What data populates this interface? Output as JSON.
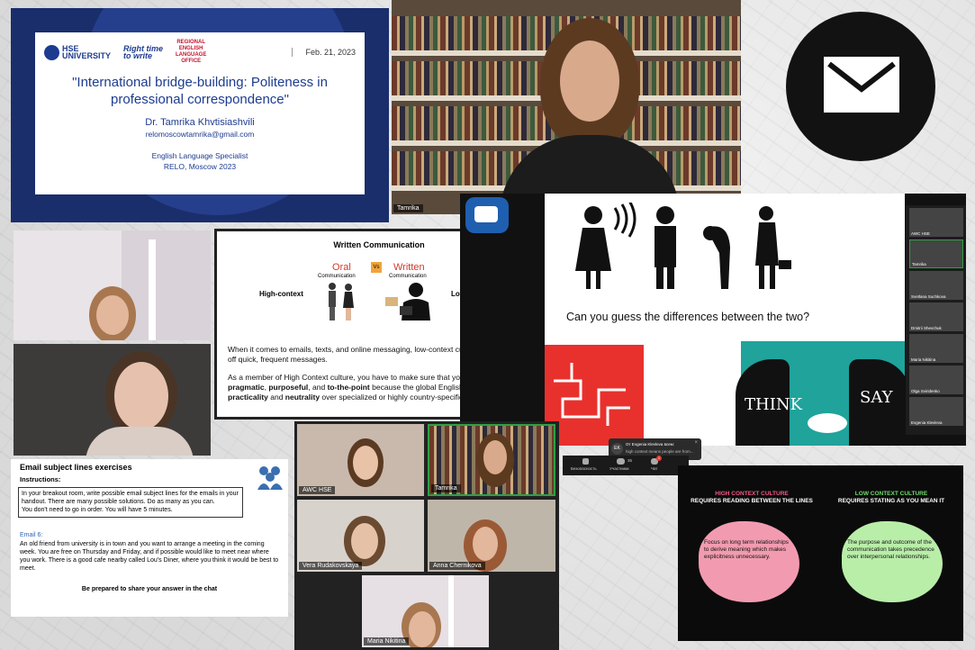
{
  "title_slide": {
    "logos": {
      "hse": "HSE\nUNIVERSITY",
      "right_time": "Right time\nto write",
      "relo": "REGIONAL\nENGLISH\nLANGUAGE\nOFFICE"
    },
    "date": "Feb. 21, 2023",
    "title": "\"International bridge-building: Politeness in professional correspondence\"",
    "presenter": "Dr. Tamrika Khvtisiashvili",
    "email": "relomoscowtamrika@gmail.com",
    "role": "English Language Specialist",
    "org": "RELO, Moscow 2023"
  },
  "speaker_video": {
    "name": "Tamrika"
  },
  "mail_icon": {
    "icon": "envelope-icon",
    "bg": "#121212"
  },
  "written_comm": {
    "title": "Written Communication",
    "oral": "Oral",
    "oral_sub": "Communication",
    "vs": "Vs",
    "written": "Written",
    "written_sub": "Communication",
    "high": "High-context",
    "low": "Low-context",
    "p1": "When it comes to emails, texts, and online messaging, low-context cultures use it to fire off quick, frequent messages.",
    "p2_a": "As a member of High Context culture, you have to make sure that your language is ",
    "p2_b": "pragmatic",
    "p2_c": ", ",
    "p2_d": "purposeful",
    "p2_e": ", and ",
    "p2_f": "to-the-point",
    "p2_g": " because the global English mindset favors ",
    "p2_h": "practicality",
    "p2_i": " and ",
    "p2_j": "neutrality",
    "p2_k": " over specialized or highly country-specific terms."
  },
  "think_say": {
    "question": "Can you guess the differences between the two?",
    "think": "THINK",
    "say": "SAY"
  },
  "gallery": [
    {
      "name": "AWC HSE"
    },
    {
      "name": "Tamrika"
    },
    {
      "name": "Svetlana Suchkova"
    },
    {
      "name": "Dmitrii Shevchuk"
    },
    {
      "name": "Maria Nikitina"
    },
    {
      "name": "Olga Sviridenko"
    },
    {
      "name": "Evgenia Klevleva"
    }
  ],
  "toolbar": {
    "security": "Безопасность",
    "participants": "Участники",
    "participants_count": "35",
    "chat": "Чат",
    "chat_badge": "1"
  },
  "toast": {
    "initials": "EK",
    "from": "От Evgenia Klevleva всем:",
    "text": "high context means people are from..."
  },
  "email_slide": {
    "title": "Email subject lines exercises",
    "instructions_label": "Instructions:",
    "instructions": "In your breakout room, write possible email subject lines for the emails in your handout. There are many possible solutions. Do as many as you can.\nYou don't need to go in order. You will have 5 minutes.",
    "email_label": "Email 6:",
    "email_body": "An old friend from university is in town and you want to arrange a meeting in the coming week. You are free on Thursday and Friday, and if possible would like to meet near where you work. There is a good cafe nearby called Lou's Diner, where you think it would be best to meet.",
    "footer": "Be prepared to share your answer in the chat"
  },
  "video_grid": [
    {
      "name": "AWC HSE"
    },
    {
      "name": "Tamrika"
    },
    {
      "name": "Vera Rudakovskaya"
    },
    {
      "name": "Anna Chernikova"
    },
    {
      "name": "Maria Nikitina"
    }
  ],
  "context_slide": {
    "high_title": "HIGH CONTEXT CULTURE",
    "high_sub": "REQUIRES READING BETWEEN THE LINES",
    "high_text": "Focus on long term relationships to derive meaning which makes explicitness unnecessary.",
    "low_title": "LOW CONTEXT CULTURE",
    "low_sub": "REQUIRES STATING AS YOU MEAN IT",
    "low_text": "The purpose and outcome of the communication takes precedence over interpersonal relationships.",
    "high_color": "#f29bb0",
    "low_color": "#b9eea9",
    "high_title_color": "#f05a86",
    "low_title_color": "#6fdc6a"
  }
}
